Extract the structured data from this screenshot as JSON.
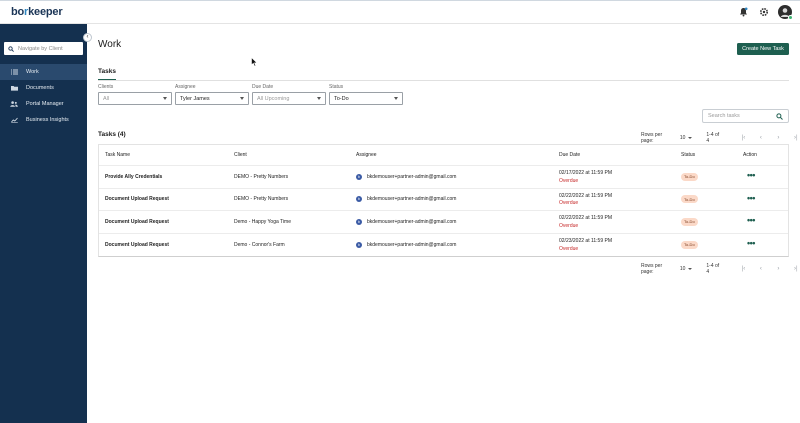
{
  "header": {
    "logo_main": "bo",
    "logo_accent": "r",
    "logo_rest": "keeper"
  },
  "sidebar": {
    "search_placeholder": "Navigate by Client",
    "items": [
      {
        "label": "Work",
        "icon": "list-icon",
        "active": true
      },
      {
        "label": "Documents",
        "icon": "folder-icon",
        "active": false
      },
      {
        "label": "Portal Manager",
        "icon": "users-icon",
        "active": false
      },
      {
        "label": "Business Insights",
        "icon": "chart-icon",
        "active": false
      }
    ]
  },
  "main": {
    "title": "Work",
    "create_button": "Create New Task",
    "tab": "Tasks",
    "filters": {
      "clients": {
        "label": "Clients",
        "placeholder": "All"
      },
      "assignee": {
        "label": "Assignee",
        "value": "Tyler James"
      },
      "due_date": {
        "label": "Due Date",
        "placeholder": "All Upcoming"
      },
      "status": {
        "label": "Status",
        "value": "To-Do"
      }
    },
    "search_placeholder": "Search tasks",
    "tasks_heading": "Tasks (4)",
    "pager": {
      "rows_label": "Rows per page:",
      "rows_value": "10",
      "range": "1-4 of 4"
    },
    "columns": [
      "Task Name",
      "Client",
      "Assignee",
      "Due Date",
      "Status",
      "Action"
    ],
    "rows": [
      {
        "task": "Provide Ally Credentials",
        "client": "DEMO - Pretty Numbers",
        "assignee_initial": "b",
        "assignee": "bkdemouser+partner-admin@gmail.com",
        "due": "02/17/2022 at 11:59 PM",
        "due_status": "Overdue",
        "status": "To-Do"
      },
      {
        "task": "Document Upload Request",
        "client": "DEMO - Pretty Numbers",
        "assignee_initial": "b",
        "assignee": "bkdemouser+partner-admin@gmail.com",
        "due": "02/22/2022 at 11:59 PM",
        "due_status": "Overdue",
        "status": "To-Do"
      },
      {
        "task": "Document Upload Request",
        "client": "Demo - Happy Yoga Time",
        "assignee_initial": "b",
        "assignee": "bkdemouser+partner-admin@gmail.com",
        "due": "02/22/2022 at 11:59 PM",
        "due_status": "Overdue",
        "status": "To-Do"
      },
      {
        "task": "Document Upload Request",
        "client": "Demo - Connor's Farm",
        "assignee_initial": "b",
        "assignee": "bkdemouser+partner-admin@gmail.com",
        "due": "02/23/2022 at 11:59 PM",
        "due_status": "Overdue",
        "status": "To-Do"
      }
    ]
  },
  "colors": {
    "sidebar": "#14304f",
    "accent": "#1e5f50",
    "overdue": "#c62828",
    "badge": "#fbd9c8"
  }
}
